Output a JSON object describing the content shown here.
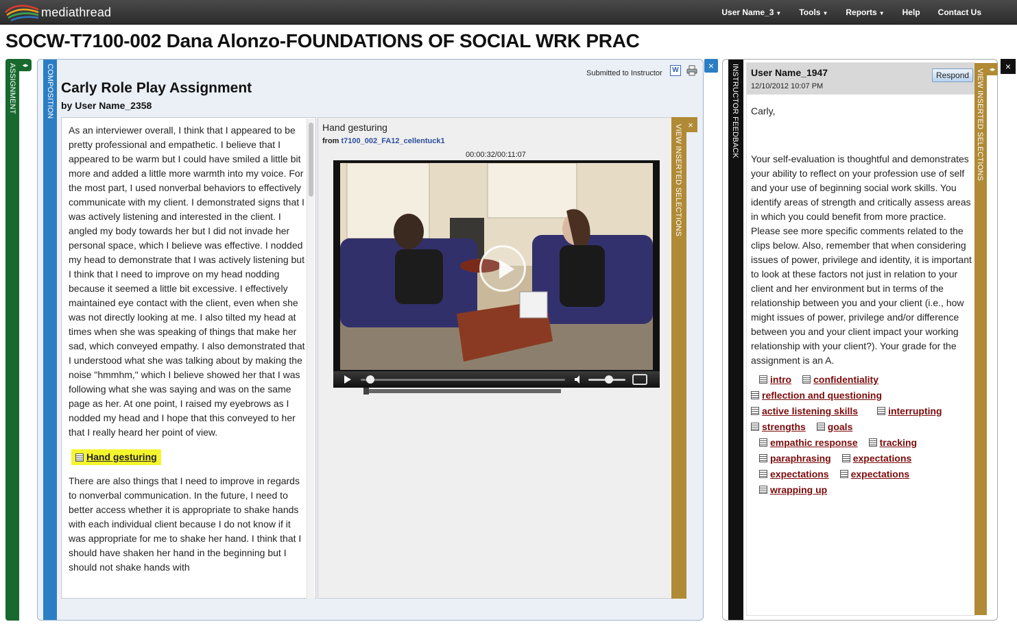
{
  "app": {
    "name": "mediathread"
  },
  "nav": {
    "user": "User Name_3",
    "tools": "Tools",
    "reports": "Reports",
    "help": "Help",
    "contact": "Contact Us"
  },
  "course_title": "SOCW-T7100-002 Dana Alonzo-FOUNDATIONS OF SOCIAL WRK PRAC",
  "assignment_tab": {
    "label": "ASSIGNMENT",
    "toggle": "◂▸"
  },
  "composition": {
    "tab_label": "COMPOSITION",
    "close": "×",
    "status": "Submitted to Instructor",
    "word_icon": "W",
    "title": "Carly Role Play Assignment",
    "byline": "by User Name_2358",
    "paragraph1": "As an interviewer overall, I think that I appeared to be pretty professional and empathetic. I believe that I appeared to be warm but I could have smiled a little bit more and added a little more warmth into my voice. For the most part, I used nonverbal behaviors to effectively communicate with my client. I demonstrated signs that I was actively listening and interested in the client. I angled my body towards her but I did not invade her personal space, which I believe was effective. I nodded my head to demonstrate that I was actively listening but I think that I need to improve on my head nodding because it seemed a little bit excessive. I effectively maintained eye contact with the client, even when she was not directly looking at me. I also tilted my head at times when she was speaking of things that make her sad, which conveyed empathy. I also demonstrated that I understood what she was talking about by making the noise \"hmmhm,\" which I believe showed her that I was following what she was saying and was on the same page as her. At one point, I raised my eyebrows as I nodded my head and I hope that this conveyed to her that I really heard her point of view.",
    "inline_clip": "Hand gesturing",
    "paragraph2": "There are also things that I need to improve in regards to nonverbal communication. In the future, I need to better access whether it is appropriate to shake hands with each individual client because I do not know if it was appropriate for me to shake her hand. I think that I should have shaken her hand in the beginning but I should not shake hands with",
    "selections_label": "VIEW INSERTED SELECTIONS",
    "selections_close": "×"
  },
  "media": {
    "clip_title": "Hand gesturing",
    "from_label": "from",
    "from_source": "t7100_002_FA12_cellentuck1",
    "timecode": "00:00:32/00:11:07",
    "progress_fraction": 0.048,
    "volume_fraction": 0.55
  },
  "feedback": {
    "tab_label": "INSTRUCTOR FEEDBACK",
    "close": "×",
    "author": "User Name_1947",
    "date": "12/10/2012 10:07 PM",
    "respond": "Respond",
    "greeting": "Carly,",
    "body": "Your self-evaluation is thoughtful and demonstrates your ability to reflect on your profession use of self and your use of beginning social work skills.  You identify areas of strength and critically assess areas in which you could benefit from more practice. Please see more specific comments related to the clips below.  Also, remember that when considering issues of power, privilege and identity, it is important to look at these factors not just in relation to your client and her environment but in terms of the relationship between you and your client (i.e., how might issues of power, privilege and/or difference between you and your client impact your working relationship with your client?). Your grade for the assignment is an A.",
    "clips": [
      "intro",
      "confidentiality",
      "reflection and questioning",
      "active listening skills",
      "interrupting",
      "strengths",
      "goals",
      "empathic response",
      "tracking",
      "paraphrasing",
      "expectations",
      "expectations",
      "expectations",
      "wrapping up"
    ],
    "selections_label": "VIEW INSERTED SELECTIONS",
    "selections_toggle": "◂▸"
  }
}
